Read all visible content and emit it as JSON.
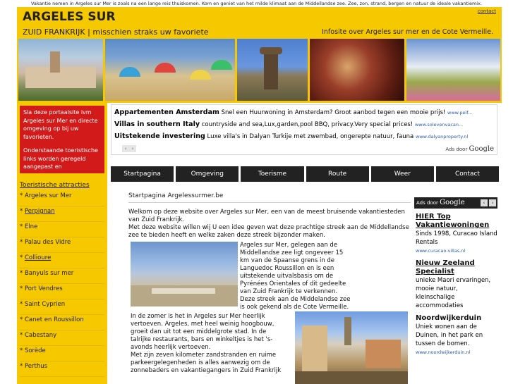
{
  "top_line": "Vakantie nemen in Argeles sur Mer is zoals na een lange reis thuiskomen. Kom en geniet van het milde klimaat aan de Middellandse zee. Zee, zon, strand, bergen en natuur de ideale vakantiemix.",
  "header": {
    "brand": "ARGELES SUR",
    "tagline": "ZUID FRANKRIJK | misschien straks uw favoriete",
    "contact_link": "contact",
    "infosite": "Infosite over Argeles sur mer en de Cote Vermeille."
  },
  "favorites_box": {
    "p1": "Sla deze portaalsite ivm Argeles sur Mer en directe omgeving op bij uw favorieten.",
    "p2": "Onderstaande toeristische links worden geregeld aangepast en"
  },
  "tourism": {
    "title": "Toeristische attracties",
    "items": [
      {
        "label": "Argeles sur Mer",
        "underline": false
      },
      {
        "label": "Perpignan",
        "underline": true
      },
      {
        "label": "Elne",
        "underline": false
      },
      {
        "label": "Palau des Vidre",
        "underline": false
      },
      {
        "label": "Collioure",
        "underline": true
      },
      {
        "label": "Banyuls sur mer",
        "underline": false
      },
      {
        "label": "Port Vendres",
        "underline": false
      },
      {
        "label": "Saint Cyprien",
        "underline": false
      },
      {
        "label": "Canet en Roussillon",
        "underline": false
      },
      {
        "label": "Cabestany",
        "underline": false
      },
      {
        "label": "Sorède",
        "underline": false
      },
      {
        "label": "Perthus",
        "underline": false
      }
    ]
  },
  "ads_top": {
    "items": [
      {
        "title": "Appartementen Amsterdam",
        "text": " Snel een Huurwoning in Amsterdam? Groot aanbod tegen een mooie prijs! ",
        "url": "www.peif..."
      },
      {
        "title": "Villas in southern Italy",
        "text": " countryside and sea,Lux,garden,pool BBQ, privacy.Very special prices! ",
        "url": "www.solevenvacan..."
      },
      {
        "title": "Uitstekende investering",
        "text": " Luxe villa's in Dalyan Turkije met zwembad, ongerepte natuur, fauna ",
        "url": "www.dalyanproperty.nl"
      }
    ],
    "ads_by": "Ads door",
    "google": "Google"
  },
  "nav": [
    "Startpagina",
    "Omgeving",
    "Toerisme",
    "Route",
    "Weer",
    "Contact"
  ],
  "breadcrumb": "Startpagina Argelessurmer.be",
  "content": {
    "p1": "Welkom op deze website over Argeles sur Mer, een van de meest bruisende vakantiesteden van Zuid Frankrijk.",
    "p2": "Met deze website willen wij U een idee geven wat deze prachtige streek aan de Middellandse zee te bieden heeft en  welke zaken deze streek bijzonder maken.",
    "side_p1": "Argeles sur Mer, gelegen aan de Middellandse zee ligt ongeveer 15 km van de Spaanse grens in de Languedoc Roussillon en is een uitstekende uitvalsbasis om de Pyrénées Orientales of dit gedeelte van Zuid Frankrijk te verkennen.",
    "side_p2": "Deze streek aan de Middelandse zee is ook gekend als de Cote Vermeille.",
    "p3": "In de zomer is het in Argeles sur Mer heerlijk vertoeven. Argeles, met heel weinig hoogbouw, groeit dan uit tot een middelgrote stad. In de talrijke restaurants, bars en winkeltjes is het 's-avonds heerlijk vertoeven.",
    "p4": "Met zijn zeven kilometer zandstranden en ruime parkeergelegenheden is alles aanwezig om de zonnebaders en vakantiegangers in Zuid Frankrijk"
  },
  "right_ads": {
    "ads_by": "Ads door",
    "google": "Google",
    "items": [
      {
        "title": "HIER Top Vakantiewoningen",
        "underline": true,
        "text": "Sinds 1998, Curacao Island Rentals",
        "url": "www.curacao-villas.nl"
      },
      {
        "title": "Nieuw Zeeland Specialist",
        "underline": true,
        "text": "unieke Maori ervaringen, mooie natuur, kleinschalige accommodaties",
        "url": ""
      },
      {
        "title": "Noordwijkerduin",
        "underline": false,
        "text": "Uniek wonen aan de Duinen, in het park en tussen de bomen.",
        "url": "www.noordwijkerduin.nl"
      }
    ]
  }
}
